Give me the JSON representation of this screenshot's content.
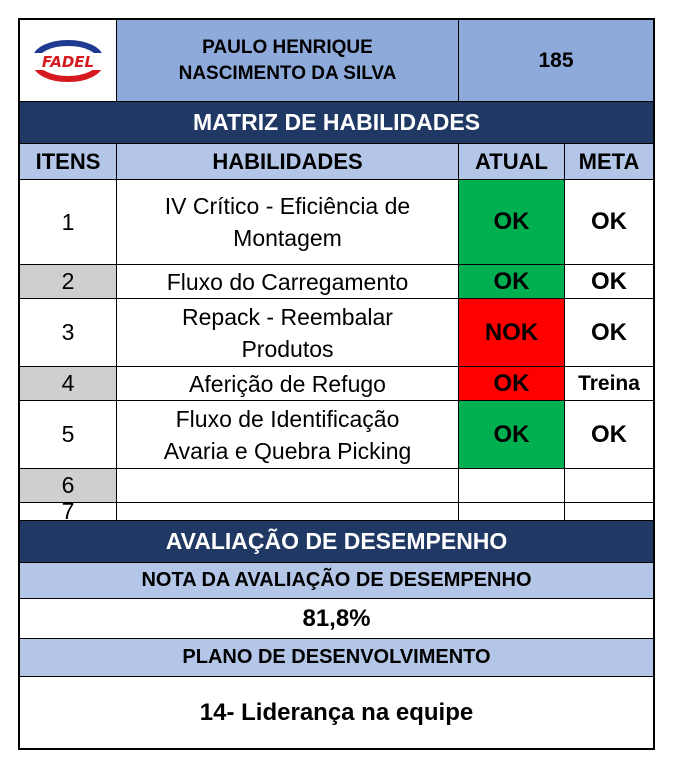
{
  "header": {
    "logo_text": "FADEL",
    "employee_name_line1": "PAULO HENRIQUE",
    "employee_name_line2": "NASCIMENTO DA SILVA",
    "employee_id": "185"
  },
  "matrix": {
    "title": "MATRIZ DE HABILIDADES",
    "columns": {
      "itens": "ITENS",
      "habilidades": "HABILIDADES",
      "atual": "ATUAL",
      "meta": "META"
    },
    "rows": [
      {
        "item": "1",
        "hab1": "IV Crítico - Eficiência de",
        "hab2": "Montagem",
        "atual": "OK",
        "meta": "OK",
        "status": "green"
      },
      {
        "item": "2",
        "hab1": "Fluxo do Carregamento",
        "hab2": "",
        "atual": "OK",
        "meta": "OK",
        "status": "green"
      },
      {
        "item": "3",
        "hab1": "Repack - Reembalar",
        "hab2": "Produtos",
        "atual": "NOK",
        "meta": "OK",
        "status": "red"
      },
      {
        "item": "4",
        "hab1": "Aferição de Refugo",
        "hab2": "",
        "atual": "OK",
        "meta": "Treina",
        "status": "red"
      },
      {
        "item": "5",
        "hab1": "Fluxo de Identificação",
        "hab2": "Avaria e Quebra Picking",
        "atual": "OK",
        "meta": "OK",
        "status": "green"
      },
      {
        "item": "6",
        "hab1": "",
        "hab2": "",
        "atual": "",
        "meta": "",
        "status": "none"
      },
      {
        "item": "7",
        "hab1": "",
        "hab2": "",
        "atual": "",
        "meta": "",
        "status": "none"
      }
    ]
  },
  "evaluation": {
    "title": "AVALIAÇÃO DE DESEMPENHO",
    "score_label": "NOTA DA AVALIAÇÃO DE DESEMPENHO",
    "score_value": "81,8%",
    "plan_label": "PLANO DE DESENVOLVIMENTO",
    "plan_value": "14- Liderança na equipe"
  },
  "colors": {
    "navy": "#1f3864",
    "header_blue": "#8eaadb",
    "light_blue": "#b4c6e7",
    "ok_green": "#00b050",
    "nok_red": "#ff0000",
    "item_grey": "#d0cece"
  }
}
